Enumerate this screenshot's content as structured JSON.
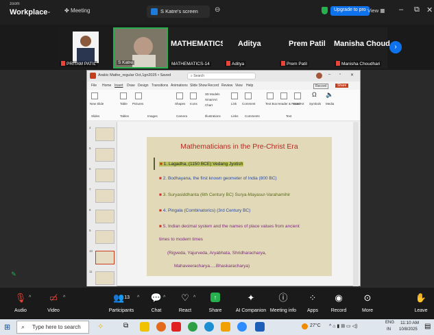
{
  "titlebar": {
    "brand_small": "zoom",
    "brand": "Workplace",
    "meeting": "Meeting",
    "share_label": "S Katre's screen",
    "upgrade": "Upgrade to pro",
    "view": "View"
  },
  "participants": [
    {
      "name": "PRITAM PATIL"
    },
    {
      "name": "S Katre"
    },
    {
      "big": "MATHEMATICS...",
      "name": "MATHEMATICS-14"
    },
    {
      "big": "Aditya",
      "name": "Aditya"
    },
    {
      "big": "Prem Patil",
      "name": "Prem Patil"
    },
    {
      "big": "Manisha Choud...",
      "name": "Manisha Choudhari"
    }
  ],
  "ppt": {
    "file": "Arabic Mathe_regular Oct,1gn2025 • Saved",
    "search": "Search",
    "menus": [
      "File",
      "Home",
      "Insert",
      "Draw",
      "Design",
      "Transitions",
      "Animations",
      "Slide Show",
      "Record",
      "Review",
      "View",
      "Help"
    ],
    "ribbon_labels": [
      "New Slide",
      "Table",
      "Pictures",
      "Shapes",
      "Icons",
      "3D Models",
      "SmartArt",
      "Chart",
      "Link",
      "Comment",
      "Text Box",
      "Header & Footer",
      "WordArt",
      "Symbols",
      "Media"
    ],
    "groups": [
      "Slides",
      "Tables",
      "Images",
      "Camera",
      "Illustrations",
      "Links",
      "Comments",
      "Text"
    ],
    "record": "Record",
    "share": "Share",
    "thumb_numbers": [
      "4",
      "5",
      "6",
      "7",
      "8",
      "9",
      "10",
      "11"
    ]
  },
  "slide": {
    "title": "Mathematicians in the Pre-Christ Era",
    "bullets": [
      "1. Lagadha, (1150 BCE) Vedang Jyotish",
      "2. Bodhayana, the first known geometer of India (800 BC)",
      "3. Suryasiddhanta (6th Century BC) Surya-Mayasur-Varahamihir",
      "4. Pingala (Combinatorics) (3rd Century BC)",
      "5. Indian decimal system and the names of place values from ancient",
      "times to modern times",
      "(Rigveda, Yajurveda, Aryabhata, Shridharacharya,",
      "Mahaveeracharya.....Bhaskaracharya)"
    ]
  },
  "toolbar": {
    "audio": "Audio",
    "video": "Video",
    "participants": "Participants",
    "participants_count": "13",
    "chat": "Chat",
    "react": "React",
    "share": "Share",
    "ai": "AI Companion",
    "meeting_info": "Meeting info",
    "apps": "Apps",
    "record": "Record",
    "more": "More",
    "leave": "Leave"
  },
  "taskbar": {
    "search": "Type here to search",
    "temp": "27°C",
    "lang": "ENG",
    "lang2": "IN",
    "time": "11:10 AM",
    "date": "10/8/2025"
  }
}
